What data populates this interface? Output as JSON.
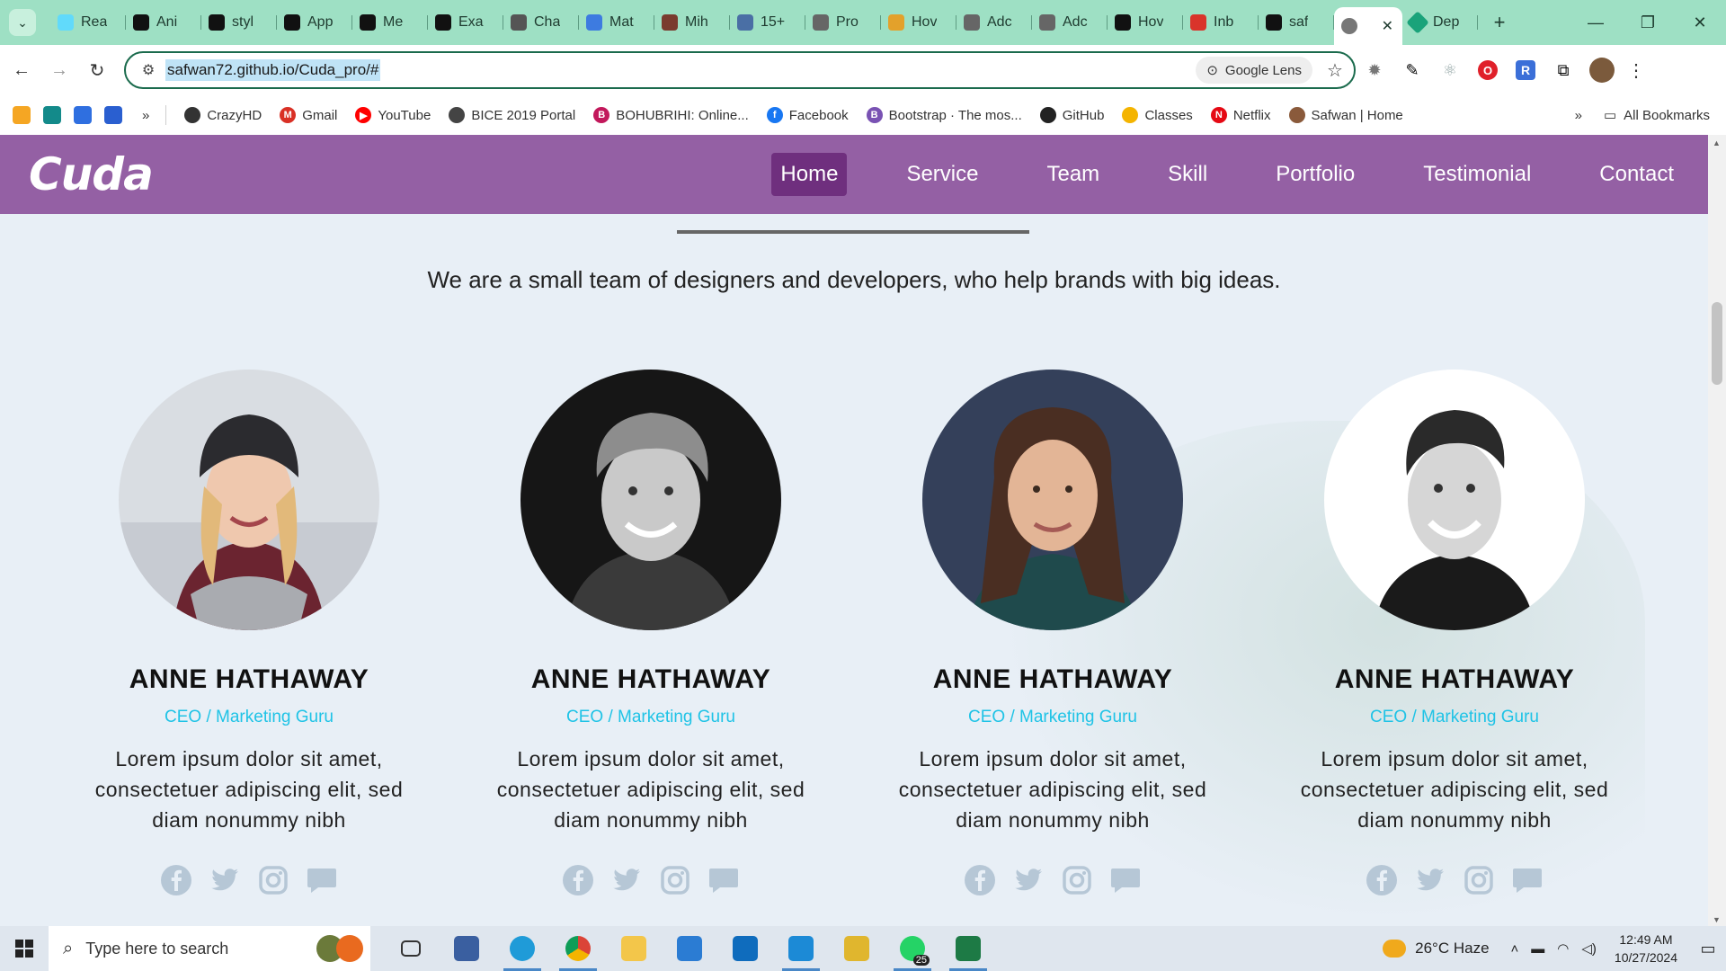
{
  "browser": {
    "tabs": [
      {
        "title": "Rea",
        "color": "#61dafb"
      },
      {
        "title": "Ani",
        "color": "#111111"
      },
      {
        "title": "styl",
        "color": "#111111"
      },
      {
        "title": "App",
        "color": "#111111"
      },
      {
        "title": "Me",
        "color": "#111111"
      },
      {
        "title": "Exa",
        "color": "#111111"
      },
      {
        "title": "Cha",
        "color": "#555555"
      },
      {
        "title": "Mat",
        "color": "#3d7be0"
      },
      {
        "title": "Mih",
        "color": "#7a3b2e"
      },
      {
        "title": "15+",
        "color": "#4a6fa5"
      },
      {
        "title": "Pro",
        "color": "#666666"
      },
      {
        "title": "Hov",
        "color": "#e3a12b"
      },
      {
        "title": "Adc",
        "color": "#666666"
      },
      {
        "title": "Adc",
        "color": "#666666"
      },
      {
        "title": "Hov",
        "color": "#111111"
      },
      {
        "title": "Inb",
        "color": "#d9342b"
      },
      {
        "title": "saf",
        "color": "#111111"
      }
    ],
    "active_tab": {
      "title": "",
      "close": "✕"
    },
    "extra_tab": {
      "title": "Dep",
      "color": "#1aa37a"
    },
    "new_tab": "+",
    "url": "safwan72.github.io/Cuda_pro/#",
    "lens_label": "Google Lens",
    "bookmarks": [
      {
        "label": "CrazyHD",
        "color": "#333333",
        "glyph": ""
      },
      {
        "label": "Gmail",
        "color": "#d93025",
        "glyph": "M"
      },
      {
        "label": "YouTube",
        "color": "#ff0000",
        "glyph": "▶"
      },
      {
        "label": "BICE 2019 Portal",
        "color": "#444444",
        "glyph": ""
      },
      {
        "label": "BOHUBRIHI: Online...",
        "color": "#c2185b",
        "glyph": "B"
      },
      {
        "label": "Facebook",
        "color": "#1877f2",
        "glyph": "f"
      },
      {
        "label": "Bootstrap · The mos...",
        "color": "#7952b3",
        "glyph": "B"
      },
      {
        "label": "GitHub",
        "color": "#222222",
        "glyph": ""
      },
      {
        "label": "Classes",
        "color": "#f4b400",
        "glyph": ""
      },
      {
        "label": "Netflix",
        "color": "#e50914",
        "glyph": "N"
      },
      {
        "label": "Safwan | Home",
        "color": "#8a5a3b",
        "glyph": ""
      }
    ],
    "all_bookmarks": "All Bookmarks",
    "accent": "#9ee0c4"
  },
  "site": {
    "logo": "Cuda",
    "nav": [
      "Home",
      "Service",
      "Team",
      "Skill",
      "Portfolio",
      "Testimonial",
      "Contact"
    ],
    "active_nav": "Home",
    "nav_color": "#9460a4",
    "tagline": "We are a small team of designers and developers, who help brands with big ideas.",
    "members": [
      {
        "name": "ANNE HATHAWAY",
        "role": "CEO / Marketing Guru",
        "bio": "Lorem ipsum dolor sit amet, consectetuer adipiscing elit, sed diam nonummy nibh",
        "photo": "woman-beanie-scarf"
      },
      {
        "name": "ANNE HATHAWAY",
        "role": "CEO / Marketing Guru",
        "bio": "Lorem ipsum dolor sit amet, consectetuer adipiscing elit, sed diam nonummy nibh",
        "photo": "man-curly-hair-bw"
      },
      {
        "name": "ANNE HATHAWAY",
        "role": "CEO / Marketing Guru",
        "bio": "Lorem ipsum dolor sit amet, consectetuer adipiscing elit, sed diam nonummy nibh",
        "photo": "woman-long-hair-brick"
      },
      {
        "name": "ANNE HATHAWAY",
        "role": "CEO / Marketing Guru",
        "bio": "Lorem ipsum dolor sit amet, consectetuer adipiscing elit, sed diam nonummy nibh",
        "photo": "man-smiling-bw"
      }
    ],
    "social_icons": [
      "facebook-icon",
      "twitter-icon",
      "instagram-icon",
      "chat-icon"
    ],
    "role_color": "#1fc3e6"
  },
  "taskbar": {
    "search_placeholder": "Type here to search",
    "weather": "26°C  Haze",
    "time": "12:49 AM",
    "date": "10/27/2024",
    "whatsapp_badge": "25"
  }
}
